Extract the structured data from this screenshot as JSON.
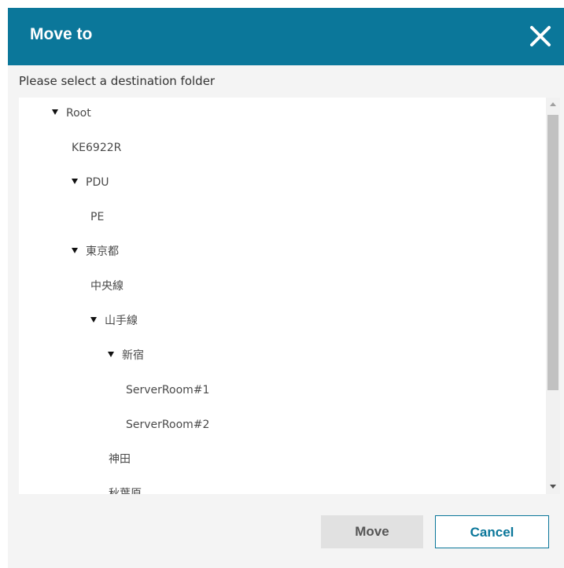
{
  "dialog": {
    "title": "Move to",
    "instruction": "Please select a destination folder"
  },
  "tree": {
    "items": [
      {
        "label": "Root",
        "expanded": true,
        "level": 0
      },
      {
        "label": "KE6922R",
        "expanded": null,
        "level": 1
      },
      {
        "label": "PDU",
        "expanded": true,
        "level": 1
      },
      {
        "label": "PE",
        "expanded": null,
        "level": 2
      },
      {
        "label": "東京都",
        "expanded": true,
        "level": 1
      },
      {
        "label": "中央線",
        "expanded": null,
        "level": 2
      },
      {
        "label": "山手線",
        "expanded": true,
        "level": 2
      },
      {
        "label": "新宿",
        "expanded": true,
        "level": 3
      },
      {
        "label": "ServerRoom#1",
        "expanded": null,
        "level": 4
      },
      {
        "label": "ServerRoom#2",
        "expanded": null,
        "level": 4
      },
      {
        "label": "神田",
        "expanded": null,
        "level": 3
      },
      {
        "label": "秋葉原",
        "expanded": null,
        "level": 3
      }
    ]
  },
  "buttons": {
    "move": "Move",
    "cancel": "Cancel"
  },
  "colors": {
    "header": "#0b779a",
    "accent": "#0b779a"
  }
}
